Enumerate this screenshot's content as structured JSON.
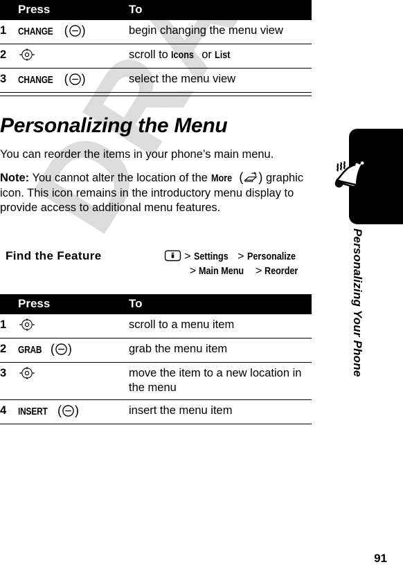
{
  "document": {
    "page_number": "91",
    "watermark": "DRAFT"
  },
  "table_top": {
    "headers": {
      "num": "",
      "press": "Press",
      "to": "To"
    },
    "rows": [
      {
        "num": "1",
        "press_label": "CHANGE",
        "press_icon": "softkey-icon",
        "to": "begin changing the menu view"
      },
      {
        "num": "2",
        "press_label": "",
        "press_icon": "navigation-key-icon",
        "to_prefix": "scroll to ",
        "to_kw1": "Icons",
        "to_mid": " or ",
        "to_kw2": "List"
      },
      {
        "num": "3",
        "press_label": "CHANGE",
        "press_icon": "softkey-icon",
        "to": "select the menu view"
      }
    ]
  },
  "section": {
    "title": "Personalizing the Menu",
    "intro": "You can reorder the items in your phone’s main menu.",
    "note_label": "Note:",
    "note_part1": " You cannot alter the location of the ",
    "note_keyword": "More",
    "note_part2": " graphic icon. This icon remains in the introductory menu display to provide access to additional menu features."
  },
  "find_the_feature": {
    "label": "Find the Feature",
    "line1": {
      "icon": "menu-key-icon",
      "sep1": ">",
      "item1": "Settings",
      "sep2": ">",
      "item2": "Personalize"
    },
    "line2": {
      "sep1": ">",
      "item1": "Main Menu",
      "sep2": ">",
      "item2": "Reorder"
    }
  },
  "table_bottom": {
    "headers": {
      "num": "",
      "press": "Press",
      "to": "To"
    },
    "rows": [
      {
        "num": "1",
        "press_label": "",
        "press_icon": "navigation-key-icon",
        "to": "scroll to a menu item"
      },
      {
        "num": "2",
        "press_label": "GRAB",
        "press_icon": "softkey-icon",
        "to": "grab the menu item"
      },
      {
        "num": "3",
        "press_label": "",
        "press_icon": "navigation-key-icon",
        "to": "move the item to a new location in the menu"
      },
      {
        "num": "4",
        "press_label": "INSERT",
        "press_icon": "softkey-icon",
        "to": "insert the menu item"
      }
    ]
  },
  "sidebar": {
    "chapter_title": "Personalizing Your Phone",
    "icon": "ringing-bell-icon"
  },
  "colors": {
    "header_bg": "#000000",
    "header_text": "#ffffff",
    "body_text": "#000000",
    "watermark": "#dcdcdc",
    "page_bg": "#ffffff"
  }
}
